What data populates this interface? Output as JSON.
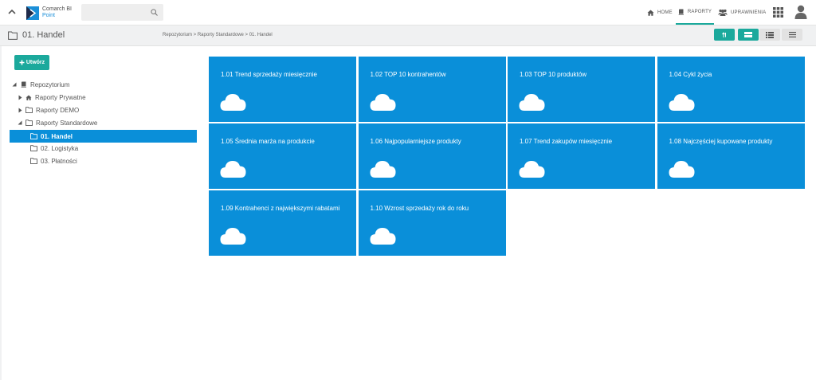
{
  "header": {
    "logo_line1": "Comarch BI",
    "logo_line2": "Point",
    "search_placeholder": "",
    "nav": [
      {
        "label": "HOME"
      },
      {
        "label": "RAPORTY"
      },
      {
        "label": "UPRAWNIENIA"
      }
    ]
  },
  "subheader": {
    "title": "01. Handel",
    "breadcrumb": "Repozytorium > Raporty Standardowe > 01. Handel"
  },
  "sidebar": {
    "create_label": "Utwórz",
    "tree": [
      {
        "label": "Repozytorium"
      },
      {
        "label": "Raporty Prywatne"
      },
      {
        "label": "Raporty DEMO"
      },
      {
        "label": "Raporty Standardowe"
      },
      {
        "label": "01. Handel"
      },
      {
        "label": "02. Logistyka"
      },
      {
        "label": "03. Płatności"
      }
    ]
  },
  "tiles": [
    {
      "title": "1.01 Trend sprzedaży miesięcznie"
    },
    {
      "title": "1.02 TOP 10 kontrahentów"
    },
    {
      "title": "1.03 TOP 10 produktów"
    },
    {
      "title": "1.04 Cykl życia"
    },
    {
      "title": "1.05 Średnia marża na produkcie"
    },
    {
      "title": "1.06 Najpopularniejsze produkty"
    },
    {
      "title": "1.07 Trend zakupów miesięcznie"
    },
    {
      "title": "1.08 Najczęściej kupowane produkty"
    },
    {
      "title": "1.09 Kontrahenci z największymi rabatami"
    },
    {
      "title": "1.10 Wzrost sprzedaży rok do roku"
    }
  ],
  "colors": {
    "accent_teal": "#1ba99c",
    "tile_blue": "#0a8fd9"
  }
}
